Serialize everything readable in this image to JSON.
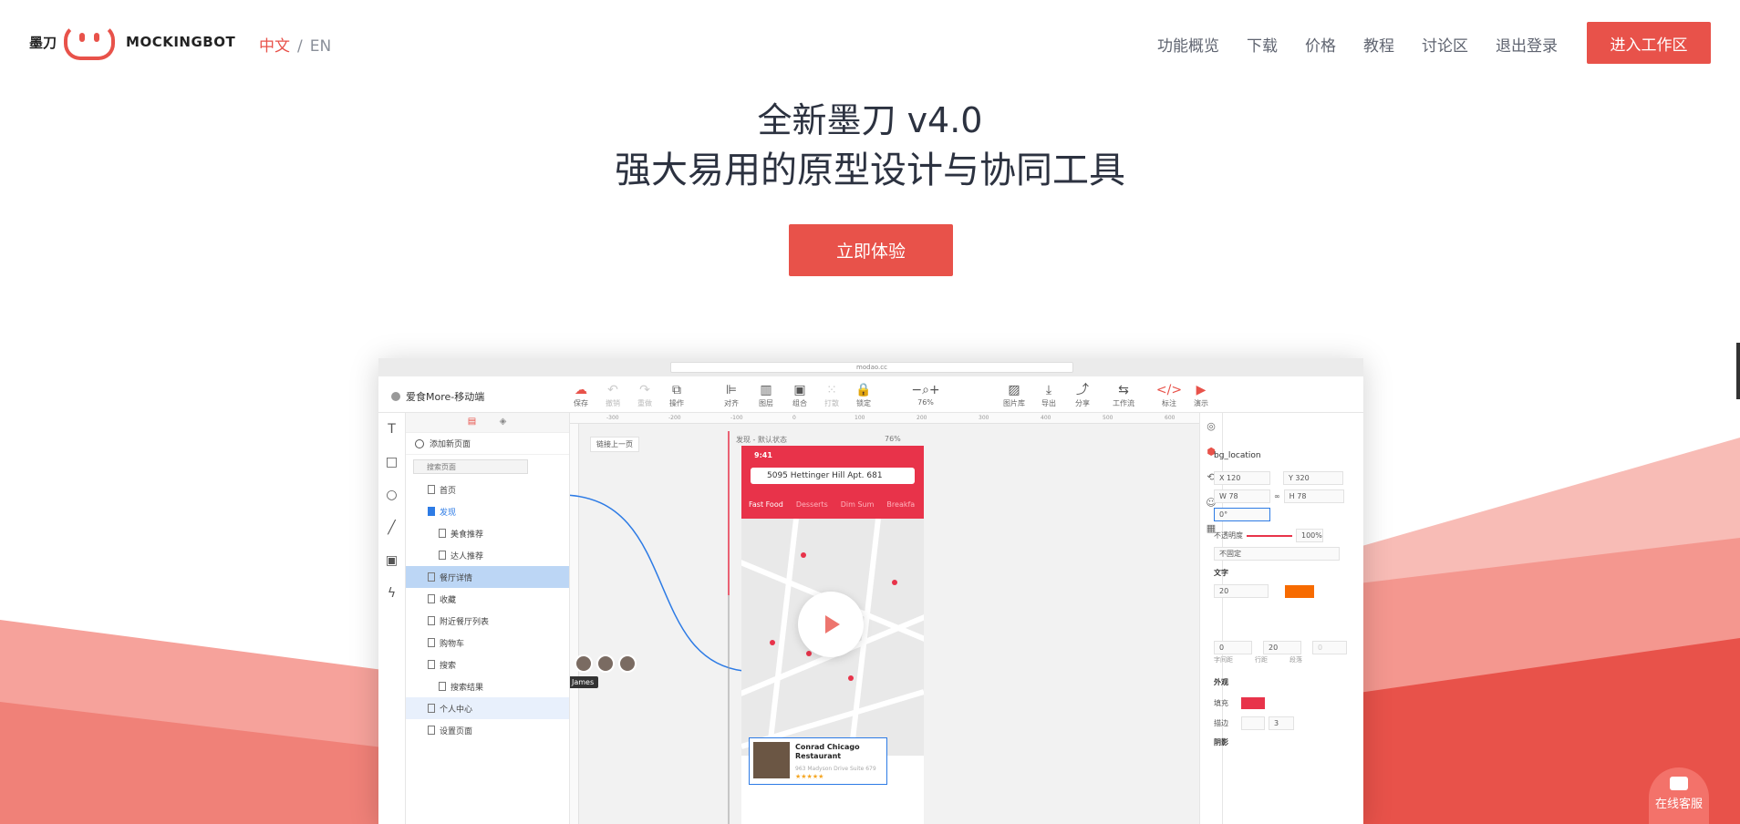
{
  "brand": {
    "cn": "墨刀",
    "en": "MOCKINGBOT"
  },
  "lang": {
    "zh": "中文",
    "sep": "/",
    "en": "EN"
  },
  "nav": [
    "功能概览",
    "下载",
    "价格",
    "教程",
    "讨论区",
    "退出登录"
  ],
  "nav_cta": "进入工作区",
  "hero": {
    "title": "全新墨刀 v4.0",
    "subtitle": "强大易用的原型设计与协同工具",
    "button": "立即体验"
  },
  "colors": {
    "accent": "#e8524a",
    "band_light": "#f6a29b",
    "band_mid": "#f08178",
    "band_dark": "#e8524a"
  },
  "app": {
    "url": "modao.cc",
    "project": "爱食More-移动端",
    "toolbar": [
      {
        "icon": "save-icon",
        "label": "保存",
        "state": "active"
      },
      {
        "icon": "undo-icon",
        "label": "撤销",
        "state": "disabled"
      },
      {
        "icon": "redo-icon",
        "label": "重做",
        "state": "disabled"
      },
      {
        "icon": "actions-icon",
        "label": "操作",
        "state": "normal"
      },
      {
        "icon": "align-icon",
        "label": "对齐",
        "state": "normal"
      },
      {
        "icon": "layers-icon",
        "label": "图层",
        "state": "normal"
      },
      {
        "icon": "group-icon",
        "label": "组合",
        "state": "normal"
      },
      {
        "icon": "ungroup-icon",
        "label": "打散",
        "state": "disabled"
      },
      {
        "icon": "lock-icon",
        "label": "锁定",
        "state": "normal"
      },
      {
        "icon": "zoom-icon",
        "label": "76%",
        "state": "normal"
      },
      {
        "icon": "image-library-icon",
        "label": "图片库",
        "state": "normal"
      },
      {
        "icon": "export-icon",
        "label": "导出",
        "state": "normal"
      },
      {
        "icon": "share-icon",
        "label": "分享",
        "state": "normal"
      },
      {
        "icon": "workflow-icon",
        "label": "工作流",
        "state": "normal"
      },
      {
        "icon": "annotate-icon",
        "label": "标注",
        "state": "normal"
      },
      {
        "icon": "preview-icon",
        "label": "演示",
        "state": "normal"
      }
    ],
    "tools": [
      "T",
      "□",
      "○",
      "╱",
      "▣",
      "ϟ"
    ],
    "add_page": "添加新页面",
    "search_placeholder": "搜索页面",
    "pages": [
      {
        "label": "首页",
        "type": "page"
      },
      {
        "label": "发现",
        "type": "folder"
      },
      {
        "label": "美食推荐",
        "type": "sub"
      },
      {
        "label": "达人推荐",
        "type": "sub"
      },
      {
        "label": "餐厅详情",
        "type": "selected"
      },
      {
        "label": "收藏",
        "type": "page"
      },
      {
        "label": "附近餐厅列表",
        "type": "page"
      },
      {
        "label": "购物车",
        "type": "page"
      },
      {
        "label": "搜索",
        "type": "page"
      },
      {
        "label": "搜索结果",
        "type": "sub"
      },
      {
        "label": "个人中心",
        "type": "hl"
      },
      {
        "label": "设置页面",
        "type": "page"
      }
    ],
    "canvas": {
      "link_prev": "链接上一页",
      "frame_label": "发现 - 默认状态",
      "frame_pct": "76%",
      "ruler_ticks": [
        "-300",
        "-200",
        "-100",
        "0",
        "100",
        "200",
        "300",
        "400",
        "500",
        "600"
      ],
      "collaborator": "James"
    },
    "phone": {
      "time": "9:41",
      "address": "5095 Hettinger Hill Apt. 681",
      "tabs": [
        "Fast Food",
        "Desserts",
        "Dim Sum",
        "Breakfa"
      ],
      "card_title": "Conrad Chicago Restaurant",
      "card_addr": "963 Madyson Drive Suite 679",
      "card_stars": "★★★★★"
    },
    "props": {
      "name": "bg_location",
      "x": "X 120",
      "y": "Y 320",
      "w": "W 78",
      "h": "H 78",
      "rot": "0°",
      "opacity_label": "不透明度",
      "opacity": "100%",
      "fix": "不固定",
      "text_section": "文字",
      "font_size": "20",
      "spacing": "0",
      "line_height": "20",
      "para": "0",
      "spacing_label": "字间距",
      "line_label": "行距",
      "para_label": "段落",
      "appearance": "外观",
      "fill": "填充",
      "stroke": "描边",
      "stroke_w": "3",
      "shadow": "阴影",
      "text_color": "#f76b00",
      "fill_color": "#e8334a"
    }
  },
  "chat": "在线客服"
}
